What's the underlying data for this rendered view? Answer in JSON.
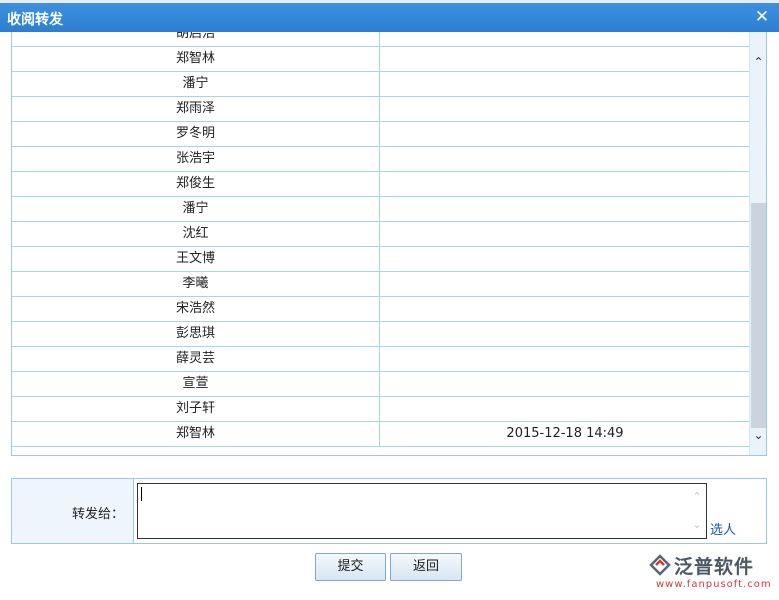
{
  "dialog": {
    "title": "收阅转发",
    "close_symbol": "✕"
  },
  "grid": {
    "rows": [
      {
        "name": "胡启浩",
        "time": ""
      },
      {
        "name": "郑智林",
        "time": ""
      },
      {
        "name": "潘宁",
        "time": ""
      },
      {
        "name": "郑雨泽",
        "time": ""
      },
      {
        "name": "罗冬明",
        "time": ""
      },
      {
        "name": "张浩宇",
        "time": ""
      },
      {
        "name": "郑俊生",
        "time": ""
      },
      {
        "name": "潘宁",
        "time": ""
      },
      {
        "name": "沈红",
        "time": ""
      },
      {
        "name": "王文博",
        "time": ""
      },
      {
        "name": "李曦",
        "time": ""
      },
      {
        "name": "宋浩然",
        "time": ""
      },
      {
        "name": "彭思琪",
        "time": ""
      },
      {
        "name": "薛灵芸",
        "time": ""
      },
      {
        "name": "宣萱",
        "time": ""
      },
      {
        "name": "刘子轩",
        "time": ""
      },
      {
        "name": "郑智林",
        "time": "2015-12-18 14:49"
      }
    ],
    "scroll_up_symbol": "⌃",
    "scroll_down_symbol": "⌄"
  },
  "form": {
    "forward_label": "转发给：",
    "forward_value": "",
    "select_people_link": "选人"
  },
  "buttons": {
    "submit": "提交",
    "back": "返回"
  },
  "watermark": {
    "brand": "泛普软件",
    "url": "www.fanpusoft.com"
  },
  "colors": {
    "titlebar": "#2b7fd2",
    "grid_border": "#a9d2f2",
    "link": "#1a56b3"
  }
}
